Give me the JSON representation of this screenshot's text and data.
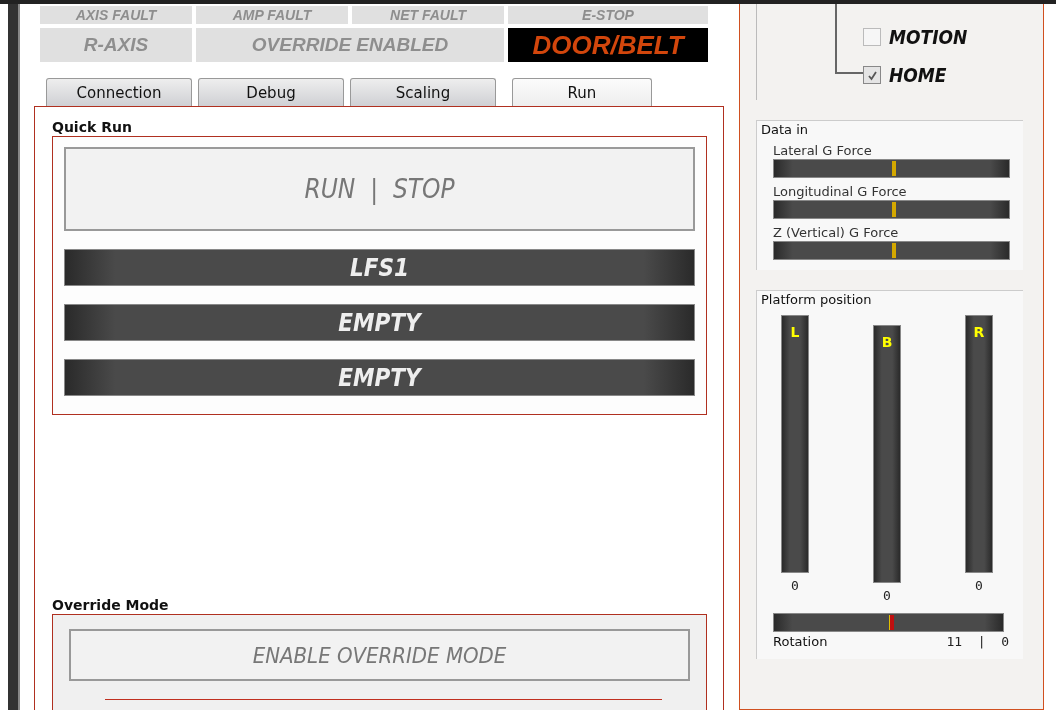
{
  "indicators": [
    {
      "label": "AXIS FAULT",
      "active": false
    },
    {
      "label": "AMP FAULT",
      "active": false
    },
    {
      "label": "NET FAULT",
      "active": false
    },
    {
      "label": "E-STOP",
      "active": false
    },
    {
      "label": "R-AXIS",
      "active": false
    },
    {
      "label": "OVERRIDE ENABLED",
      "active": false
    },
    {
      "label": "DOOR/BELT",
      "active": true
    }
  ],
  "tabs": [
    {
      "label": "Connection",
      "selected": false
    },
    {
      "label": "Debug",
      "selected": false
    },
    {
      "label": "Scaling",
      "selected": false
    },
    {
      "label": "Run",
      "selected": true
    }
  ],
  "quick_run": {
    "title": "Quick Run",
    "button": "RUN  |  STOP",
    "slots": [
      "LFS1",
      "EMPTY",
      "EMPTY"
    ]
  },
  "override": {
    "title": "Override Mode",
    "button": "ENABLE OVERRIDE MODE"
  },
  "status_tree": [
    {
      "label": "MOTION",
      "checked": false
    },
    {
      "label": "HOME",
      "checked": true
    }
  ],
  "data_in": {
    "title": "Data in",
    "sliders": [
      {
        "label": "Lateral G Force",
        "level": 0.51
      },
      {
        "label": "Longitudinal G Force",
        "level": 0.51
      },
      {
        "label": "Z (Vertical) G Force",
        "level": 0.51
      }
    ]
  },
  "platform": {
    "title": "Platform position",
    "actuators": [
      {
        "label": "L",
        "value": "0"
      },
      {
        "label": "B",
        "value": "0"
      },
      {
        "label": "R",
        "value": "0"
      }
    ],
    "rotation": {
      "label": "Rotation",
      "level": 0.51,
      "reading": "11  |  0"
    }
  }
}
